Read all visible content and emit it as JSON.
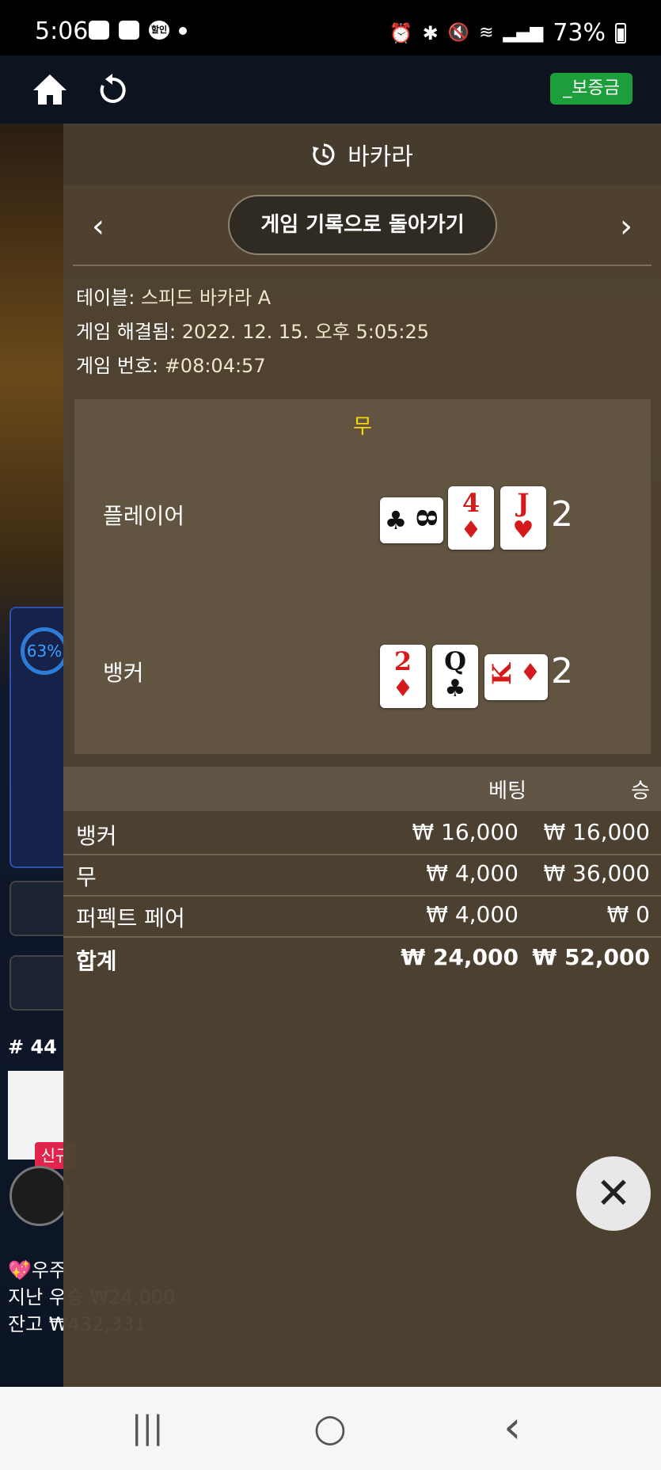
{
  "status_bar": {
    "time": "5:06",
    "battery": "73%",
    "icons": [
      "chat-icon",
      "gallery-icon",
      "sale-badge-icon",
      "dot-icon",
      "alarm-icon",
      "bluetooth-icon",
      "mute-icon",
      "wifi-icon",
      "signal-icon",
      "battery-icon"
    ],
    "sale_badge_text": "할인"
  },
  "top_bar": {
    "deposit_label": "_보증금"
  },
  "background": {
    "progress_text": "63%",
    "round_label": "# 44",
    "new_tag": "신규",
    "ticker_line1": "우주",
    "ticker_line2": "지난 우승 ₩24,000",
    "ticker_line3": "잔고 ₩432,331"
  },
  "overlay": {
    "title": "바카라",
    "back_button": "게임 기록으로 돌아가기",
    "info": {
      "table_label": "테이블:",
      "table_value": "스피드 바카라 A",
      "resolved_label": "게임 해결됨:",
      "resolved_value": "2022. 12. 15. 오후 5:05:25",
      "number_label": "게임 번호:",
      "number_value": "#08:04:57"
    },
    "result": {
      "outcome": "무",
      "player": {
        "name": "플레이어",
        "score": "2",
        "cards": [
          {
            "rank": "8",
            "suit": "♣",
            "color": "black",
            "orientation": "horizontal"
          },
          {
            "rank": "4",
            "suit": "♦",
            "color": "red",
            "orientation": "vertical"
          },
          {
            "rank": "J",
            "suit": "♥",
            "color": "red",
            "orientation": "vertical"
          }
        ]
      },
      "banker": {
        "name": "뱅커",
        "score": "2",
        "cards": [
          {
            "rank": "2",
            "suit": "♦",
            "color": "red",
            "orientation": "vertical"
          },
          {
            "rank": "Q",
            "suit": "♣",
            "color": "black",
            "orientation": "vertical"
          },
          {
            "rank": "K",
            "suit": "♦",
            "color": "red",
            "orientation": "horizontal"
          }
        ]
      }
    },
    "bets": {
      "headers": {
        "bet": "베팅",
        "win": "승"
      },
      "rows": [
        {
          "name": "뱅커",
          "bet": "₩ 16,000",
          "win": "₩ 16,000"
        },
        {
          "name": "무",
          "bet": "₩ 4,000",
          "win": "₩ 36,000"
        },
        {
          "name": "퍼펙트 페어",
          "bet": "₩ 4,000",
          "win": "₩ 0"
        }
      ],
      "total": {
        "name": "합계",
        "bet": "₩ 24,000",
        "win": "₩ 52,000"
      }
    },
    "close_label": "✕"
  },
  "nav_bar": {
    "recents": "|||",
    "home": "○",
    "back": "‹"
  },
  "colors": {
    "accent_yellow": "#f5d60c",
    "deposit_green": "#1c9e3a",
    "card_red": "#d41a1a",
    "overlay_bg": "#4e4232"
  }
}
